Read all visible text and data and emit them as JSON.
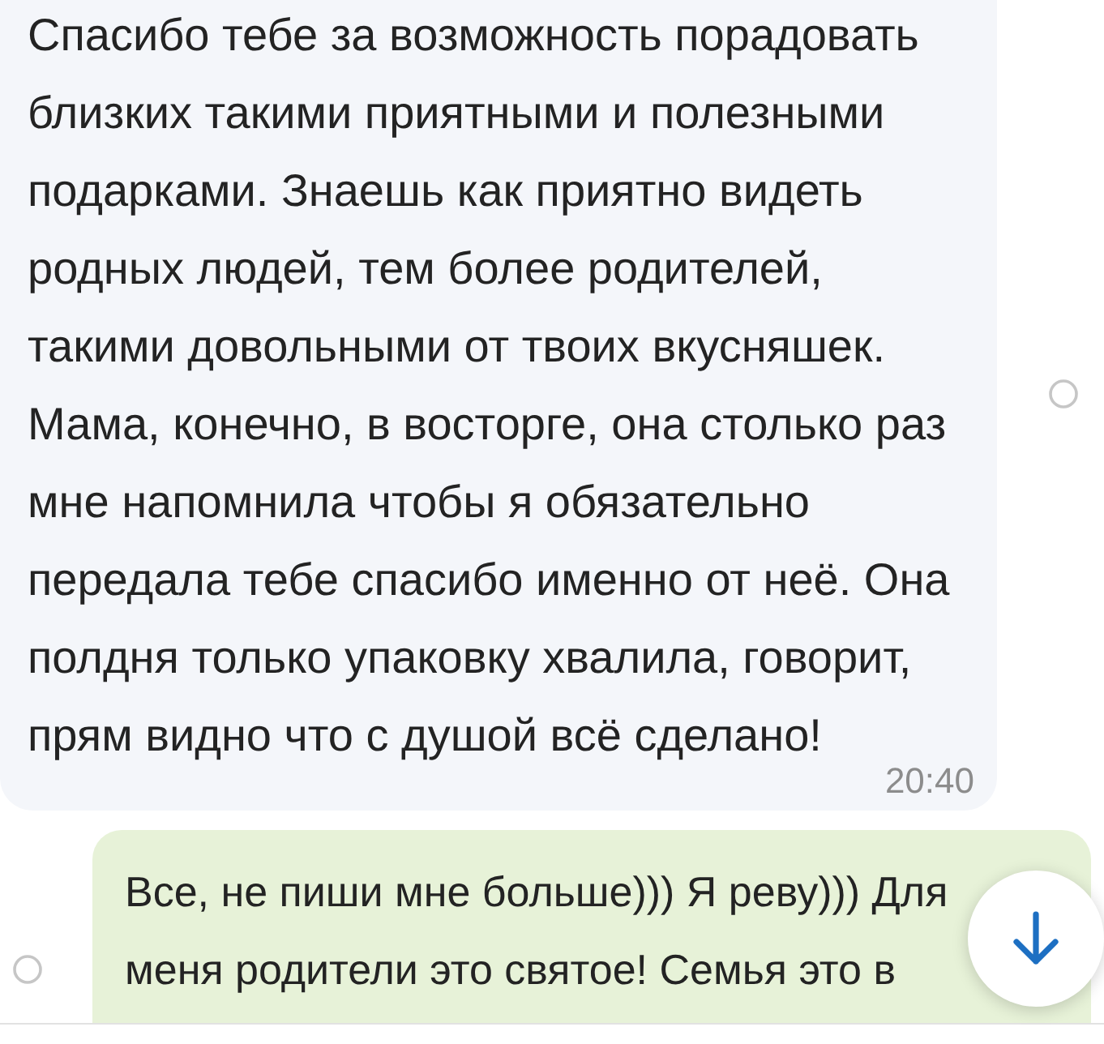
{
  "messages": [
    {
      "kind": "incoming",
      "selected": false,
      "lines": [
        "Спасибо тебе за возможность порадовать",
        "близких такими приятными и полезными",
        "подарками. Знаешь как приятно видеть",
        "родных людей, тем более родителей,",
        "такими довольными от твоих вкусняшек.",
        "Мама, конечно, в восторге, она столько раз",
        "мне напомнила чтобы я обязательно",
        "передала тебе спасибо именно от неё. Она",
        "полдня только упаковку хвалила, говорит,",
        "прям видно что с душой всё сделано!"
      ],
      "time": "20:40"
    },
    {
      "kind": "outgoing",
      "selected": false,
      "lines": [
        "Все, не пиши мне больше))) Я реву))) Для",
        "меня родители это святое! Семья это в"
      ]
    }
  ]
}
